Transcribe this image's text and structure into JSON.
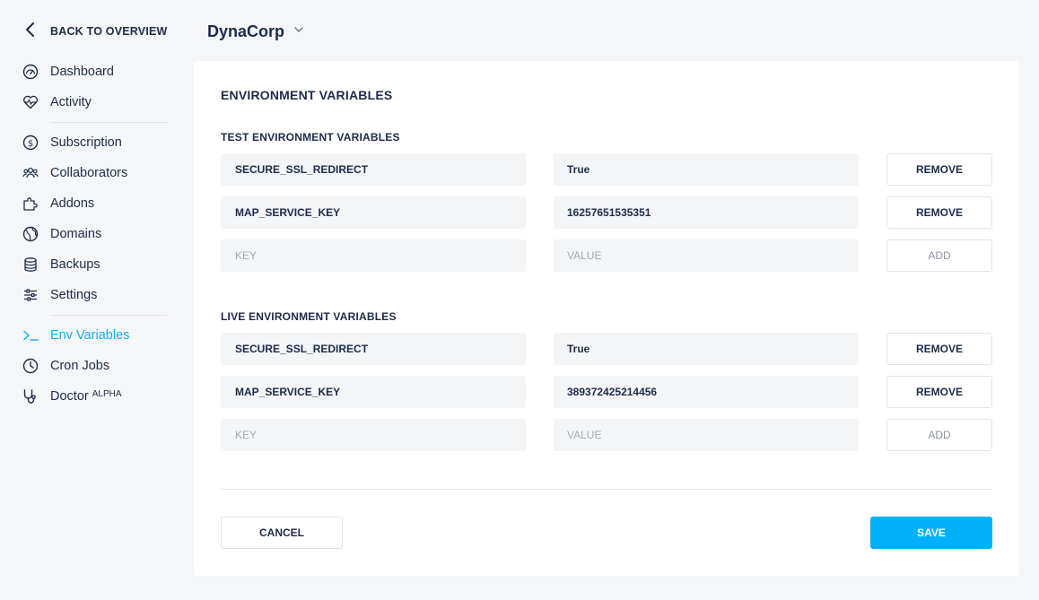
{
  "sidebar": {
    "back_label": "BACK TO OVERVIEW",
    "groups": [
      [
        {
          "label": "Dashboard",
          "icon": "dashboard-icon"
        },
        {
          "label": "Activity",
          "icon": "heartbeat-icon"
        }
      ],
      [
        {
          "label": "Subscription",
          "icon": "dollar-icon"
        },
        {
          "label": "Collaborators",
          "icon": "users-icon"
        },
        {
          "label": "Addons",
          "icon": "puzzle-icon"
        },
        {
          "label": "Domains",
          "icon": "globe-icon"
        },
        {
          "label": "Backups",
          "icon": "database-icon"
        },
        {
          "label": "Settings",
          "icon": "sliders-icon"
        }
      ],
      [
        {
          "label": "Env Variables",
          "icon": "terminal-icon",
          "active": true
        },
        {
          "label": "Cron Jobs",
          "icon": "clock-icon"
        },
        {
          "label": "Doctor",
          "icon": "stethoscope-icon",
          "badge": "ALPHA"
        }
      ]
    ]
  },
  "header": {
    "org_name": "DynaCorp"
  },
  "card": {
    "title": "ENVIRONMENT VARIABLES",
    "test": {
      "title": "TEST ENVIRONMENT VARIABLES",
      "rows": [
        {
          "key": "SECURE_SSL_REDIRECT",
          "value": "True",
          "action": "REMOVE"
        },
        {
          "key": "MAP_SERVICE_KEY",
          "value": "16257651535351",
          "action": "REMOVE"
        }
      ],
      "new_row": {
        "key_placeholder": "KEY",
        "value_placeholder": "VALUE",
        "action": "ADD"
      }
    },
    "live": {
      "title": "LIVE ENVIRONMENT VARIABLES",
      "rows": [
        {
          "key": "SECURE_SSL_REDIRECT",
          "value": "True",
          "action": "REMOVE"
        },
        {
          "key": "MAP_SERVICE_KEY",
          "value": "389372425214456",
          "action": "REMOVE"
        }
      ],
      "new_row": {
        "key_placeholder": "KEY",
        "value_placeholder": "VALUE",
        "action": "ADD"
      }
    },
    "cancel_label": "CANCEL",
    "save_label": "SAVE"
  },
  "colors": {
    "accent": "#14b0ea",
    "save_button": "#00b0f8",
    "text": "#1d2b4a",
    "background": "#f5f6f8"
  }
}
